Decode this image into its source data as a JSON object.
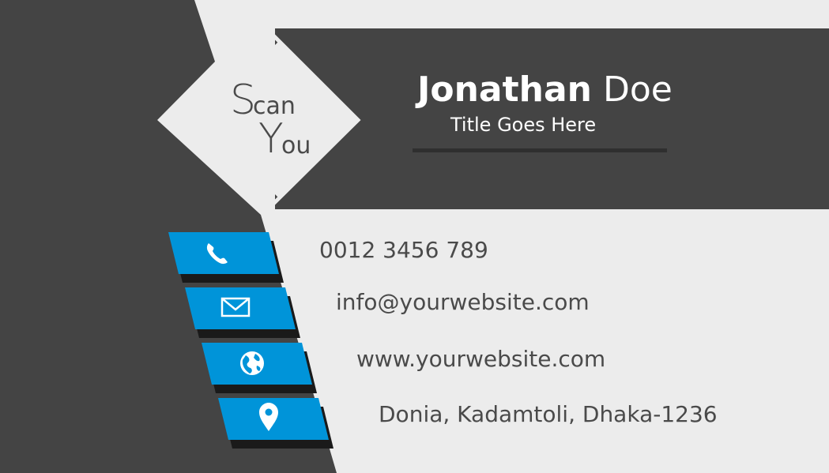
{
  "logo": {
    "s": "S",
    "can": "can",
    "y": "Y",
    "ou": "ou"
  },
  "person": {
    "first_name": "Jonathan",
    "last_name": "Doe",
    "title": "Title Goes Here"
  },
  "contacts": {
    "phone": "0012 3456 789",
    "email": "info@yourwebsite.com",
    "website": "www.yourwebsite.com",
    "address": "Donia, Kadamtoli, Dhaka-1236"
  },
  "icons": {
    "phone": "phone-icon",
    "email": "envelope-icon",
    "website": "globe-icon",
    "address": "map-pin-icon"
  },
  "colors": {
    "dark": "#444444",
    "light": "#ececec",
    "accent": "#0094d9",
    "text": "#4a4a4a"
  }
}
